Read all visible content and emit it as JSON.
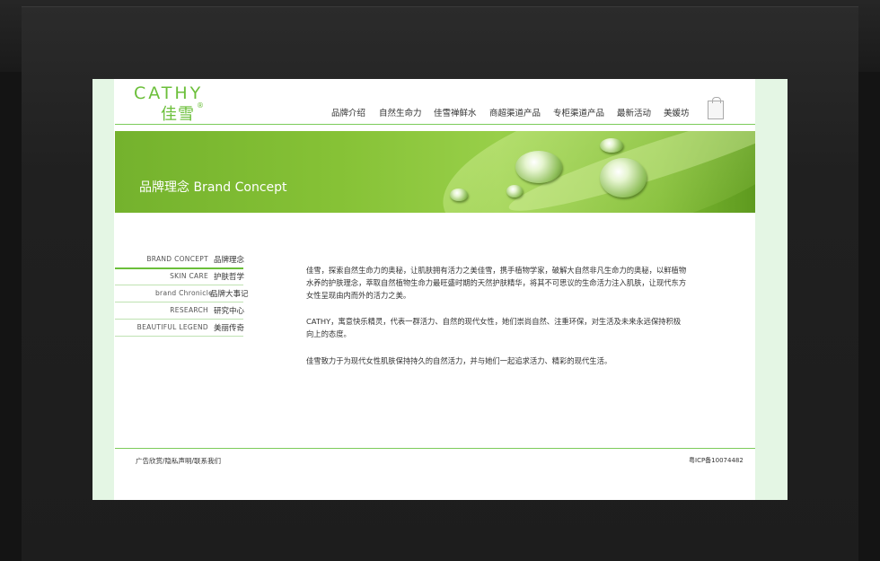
{
  "logo": {
    "en": "CATHY",
    "zh": "佳雪",
    "mark": "®"
  },
  "nav": {
    "items": [
      "品牌介绍",
      "自然生命力",
      "佳雪禅鲜水",
      "商超渠道产品",
      "专柜渠道产品",
      "最新活动",
      "美媛坊"
    ]
  },
  "header": {
    "bag_icon": "shopping-bag-icon"
  },
  "banner": {
    "title_zh": "品牌理念",
    "title_en": "Brand Concept"
  },
  "sidebar": {
    "items": [
      {
        "en": "BRAND CONCEPT",
        "zh": "品牌理念"
      },
      {
        "en": "SKIN CARE",
        "zh": "护肤哲学"
      },
      {
        "en": "brand Chronicle",
        "zh": "品牌大事记"
      },
      {
        "en": "RESEARCH",
        "zh": "研究中心"
      },
      {
        "en": "BEAUTIFUL LEGEND",
        "zh": "美丽传奇"
      }
    ]
  },
  "content": {
    "paragraphs": [
      "佳雪，探索自然生命力的奥秘，让肌肤拥有活力之美佳雪，携手植物学家，破解大自然非凡生命力的奥秘，以鲜植物水养的护肤理念，萃取自然植物生命力最旺盛时期的天然护肤精华，将其不可思议的生命活力注入肌肤，让现代东方女性呈现由内而外的活力之美。",
      "CATHY，寓意快乐精灵，代表一群活力、自然的现代女性，她们崇尚自然、注重环保，对生活及未来永远保持积极向上的态度。",
      "佳雪致力于为现代女性肌肤保持持久的自然活力，并与她们一起追求活力、精彩的现代生活。"
    ]
  },
  "footer": {
    "links": "广告欣赏/隐私声明/联系我们",
    "icp": "粤ICP备10074482"
  },
  "colors": {
    "brand_green": "#6bbf3a",
    "side_strip": "#e4f6e4"
  }
}
